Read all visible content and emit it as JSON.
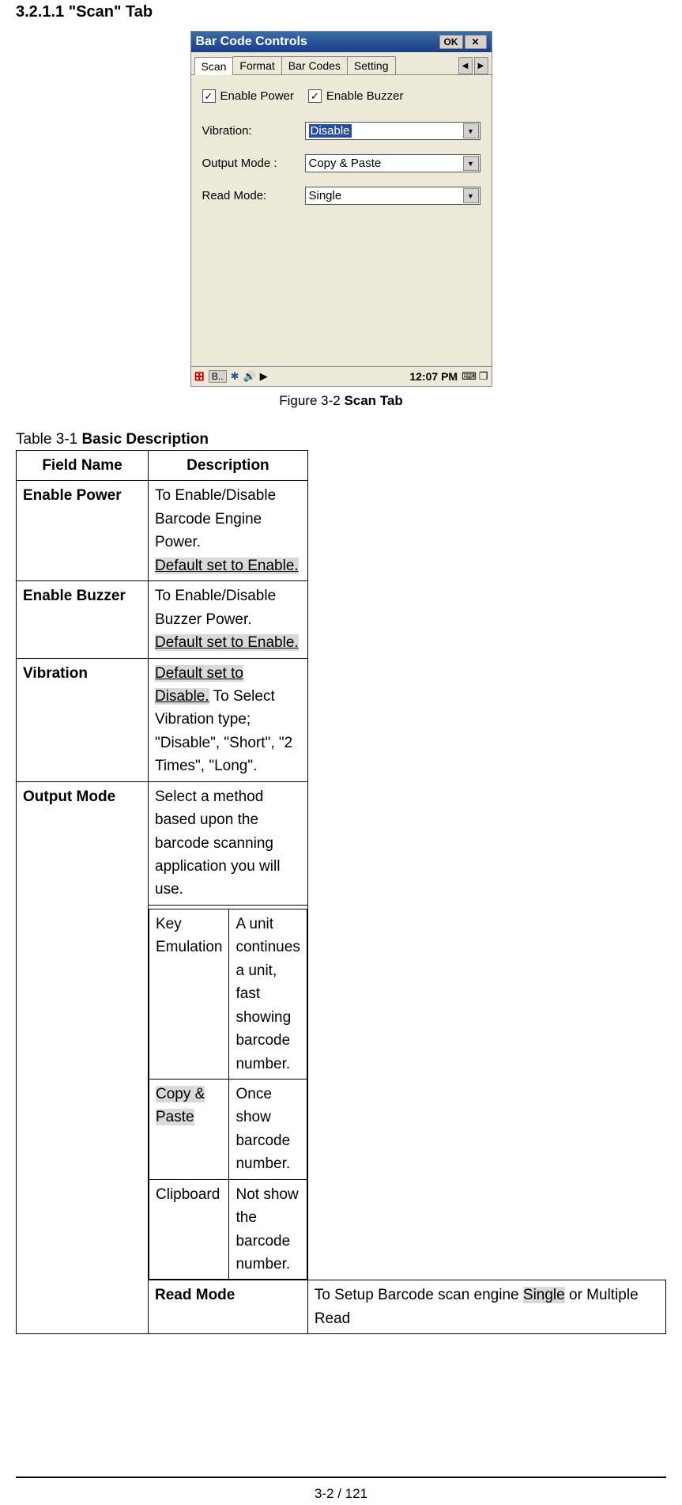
{
  "section_heading": "3.2.1.1 \"Scan\" Tab",
  "screenshot": {
    "title": "Bar Code Controls",
    "ok": "OK",
    "close_glyph": "✕",
    "tabs": [
      "Scan",
      "Format",
      "Bar Codes",
      "Setting"
    ],
    "checkboxes": {
      "enable_power": {
        "label": "Enable Power",
        "checked_glyph": "✓"
      },
      "enable_buzzer": {
        "label": "Enable Buzzer",
        "checked_glyph": "✓"
      }
    },
    "fields": {
      "vibration": {
        "label": "Vibration:",
        "value": "Disable"
      },
      "output_mode": {
        "label": "Output Mode :",
        "value": "Copy & Paste"
      },
      "read_mode": {
        "label": "Read Mode:",
        "value": "Single"
      }
    },
    "taskbar": {
      "app": "B..",
      "time": "12:07 PM"
    }
  },
  "figure_caption": {
    "prefix": "Figure 3-2 ",
    "name": "Scan Tab"
  },
  "table_caption": {
    "prefix": "Table 3-1 ",
    "name": "Basic Description"
  },
  "table": {
    "headers": {
      "field": "Field Name",
      "desc": "Description"
    },
    "rows": {
      "enable_power": {
        "name": "Enable Power",
        "desc_before": "To Enable/Disable Barcode Engine Power.",
        "desc_hl": "Default set to Enable."
      },
      "enable_buzzer": {
        "name": "Enable Buzzer",
        "desc_before": "To Enable/Disable Buzzer Power.",
        "desc_hl": "Default set to Enable."
      },
      "vibration": {
        "name": "Vibration",
        "hl": "Default set to Disable.",
        "after": " To Select Vibration type; \"Disable\", \"Short\", \"2 Times\", \"Long\"."
      },
      "output_mode": {
        "name": "Output Mode",
        "intro": "Select a method based upon the barcode scanning application you will use.",
        "options": {
          "key_emulation": {
            "label": "Key Emulation",
            "desc": "A unit continues a unit, fast showing barcode number."
          },
          "copy_paste": {
            "label": "Copy & Paste",
            "desc": "Once show barcode number."
          },
          "clipboard": {
            "label": "Clipboard",
            "desc": "Not show the barcode number."
          }
        }
      },
      "read_mode": {
        "name": "Read Mode",
        "before": "To Setup Barcode scan engine ",
        "hl": "Single",
        "after": " or Multiple Read"
      }
    }
  },
  "page_number": "3-2 / 121"
}
